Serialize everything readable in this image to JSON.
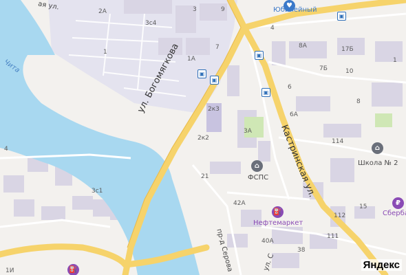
{
  "map": {
    "colors": {
      "background": "#f3f1ee",
      "water": "#a8d8f0",
      "road_major": "#f6d36b",
      "road_minor": "#ffffff",
      "building": "#e2dee9",
      "industrial": "#e3e3ee",
      "park": "#cfe7b5"
    },
    "streets": {
      "bogomyagkova": "ул. Богомягкова",
      "kastrinskaya": "Кастринская ул.",
      "serova": "пр-д Серова",
      "ul_bottom": "ул. С",
      "ul_topleft": "ая ул."
    },
    "river_label": "Чита",
    "pois": {
      "yubileyny": "Юбилейный",
      "fsps": "ФСПС",
      "neftemarket": "Нефтемаркет",
      "school": "Школа № 2",
      "sberbank": "Сбербан"
    },
    "house_numbers": {
      "h2a": "2А",
      "h3": "3",
      "h9": "9",
      "h3c4": "3с4",
      "h4": "4",
      "h1": "1",
      "h7": "7",
      "h1a": "1А",
      "h8a": "8А",
      "h17b": "17Б",
      "h1_right": "1",
      "h7b": "7Б",
      "h10": "10",
      "h6": "6",
      "h8": "8",
      "h2k3": "2к3",
      "h3a": "3А",
      "h6a": "6А",
      "h2k2": "2к2",
      "h114": "114",
      "h21": "21",
      "h4_left": "4",
      "h3c1": "3с1",
      "h42a": "42А",
      "h15": "15",
      "h112": "112",
      "h111": "111",
      "h40a": "40А",
      "h38": "38",
      "h1i": "1И"
    },
    "controls": {
      "zoom_in": "+",
      "zoom_out": "−"
    },
    "logo": "Яндекс"
  }
}
